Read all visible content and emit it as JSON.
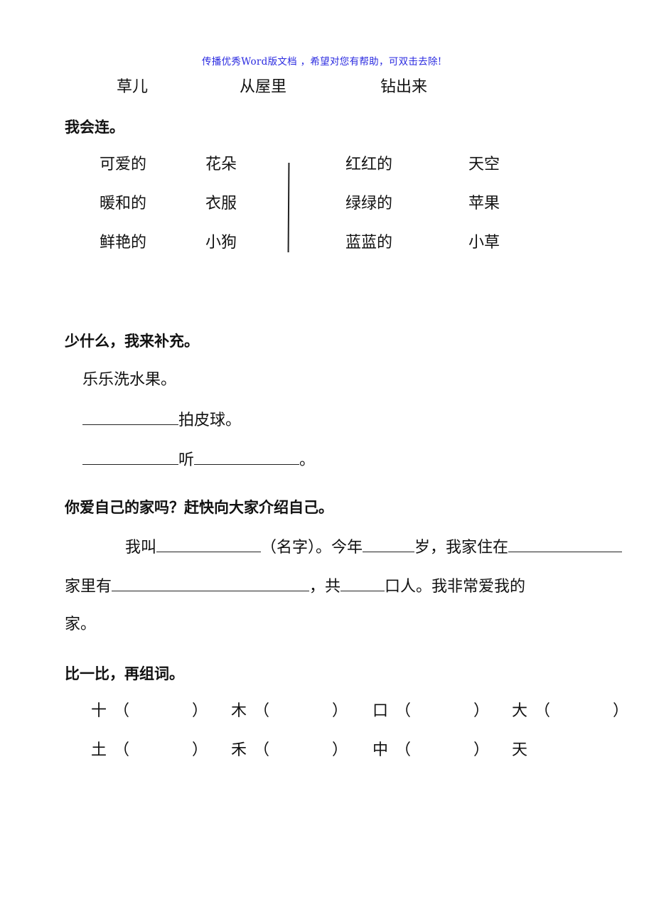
{
  "watermark": "传播优秀Word版文档 ，希望对您有帮助，可双击去除!",
  "top_row": [
    "草儿",
    "从屋里",
    "钻出来"
  ],
  "section_match": {
    "heading": "我会连。",
    "left_group": {
      "adjectives": [
        "可爱的",
        "暖和的",
        "鲜艳的"
      ],
      "nouns": [
        "花朵",
        "衣服",
        "小狗"
      ]
    },
    "right_group": {
      "adjectives": [
        "红红的",
        "绿绿的",
        "蓝蓝的"
      ],
      "nouns": [
        "天空",
        "苹果",
        "小草"
      ]
    }
  },
  "section_fill": {
    "heading": "少什么，我来补充。",
    "example": "乐乐洗水果。",
    "line2_suffix": "拍皮球。",
    "line3_middle": "听",
    "line3_end": "。"
  },
  "section_home": {
    "heading": "你爱自己的家吗？赶快向大家介绍自己。",
    "l1_a": "我叫",
    "l1_b": "（名字）。今年",
    "l1_c": "岁，我家住在",
    "l2_a": "家里有",
    "l2_b": "，共",
    "l2_c": "口人。我非常爱我的",
    "l3": "家。"
  },
  "section_compare": {
    "heading": "比一比，再组词。",
    "row1": [
      "十",
      "木",
      "口",
      "大"
    ],
    "row2": [
      "土",
      "禾",
      "中",
      "天"
    ],
    "open_paren": "（",
    "close_paren": "）"
  }
}
